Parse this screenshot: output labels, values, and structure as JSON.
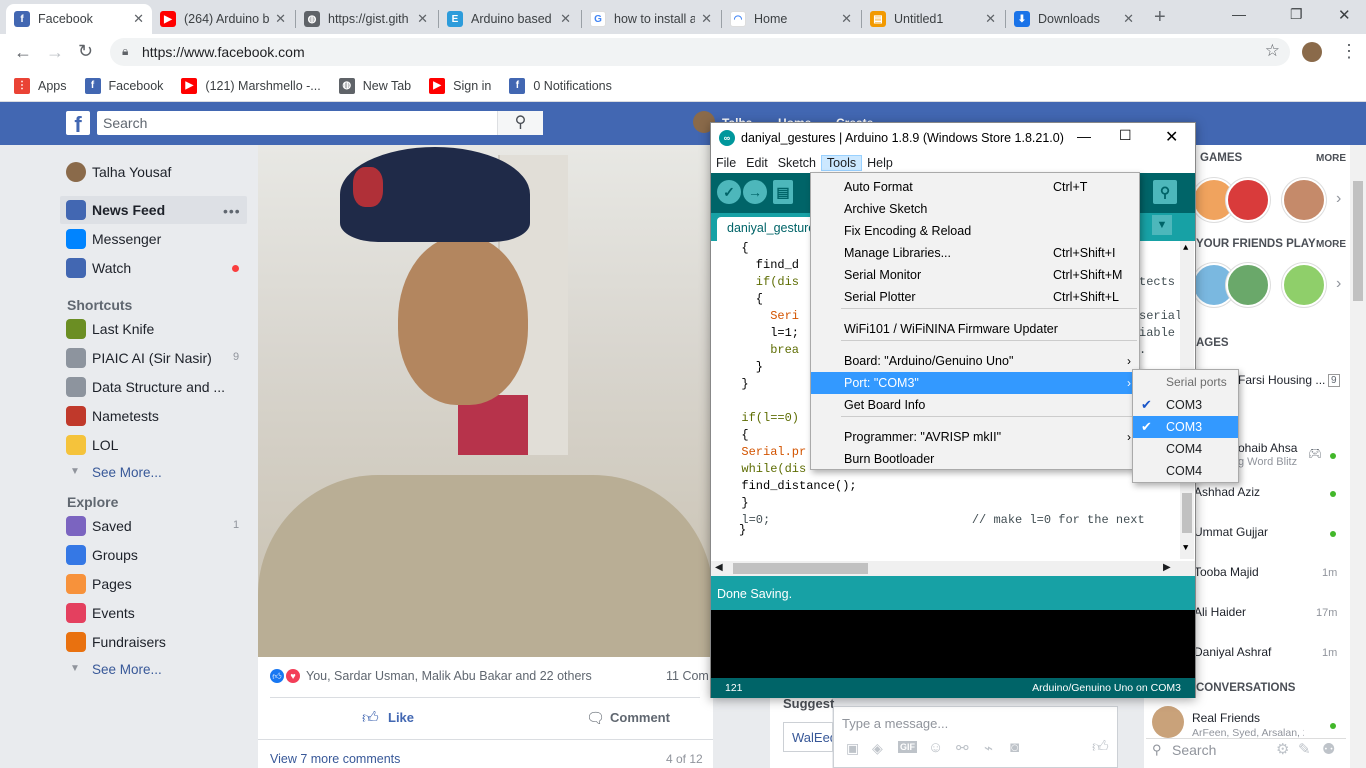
{
  "browser": {
    "tabs": [
      {
        "title": "Facebook",
        "icon": "facebook-icon",
        "color": "#4267b2",
        "glyph": "f"
      },
      {
        "title": "(264) Arduino b",
        "icon": "youtube-icon",
        "color": "#ff0000",
        "glyph": "▶"
      },
      {
        "title": "https://gist.gith",
        "icon": "globe-icon",
        "color": "#5f6368",
        "glyph": "◍"
      },
      {
        "title": "Arduino based",
        "icon": "site-e-icon",
        "color": "#2d9cdb",
        "glyph": "E"
      },
      {
        "title": "how to install a",
        "icon": "google-icon",
        "color": "#ffffff",
        "glyph": "G"
      },
      {
        "title": "Home",
        "icon": "home-site-icon",
        "color": "#ffffff",
        "glyph": "◠"
      },
      {
        "title": "Untitled1",
        "icon": "document-icon",
        "color": "#f29900",
        "glyph": "▤"
      },
      {
        "title": "Downloads",
        "icon": "download-icon",
        "color": "#1a73e8",
        "glyph": "⬇"
      }
    ],
    "url": "https://www.facebook.com",
    "bookmarks": [
      {
        "label": "Apps",
        "icon": "apps-grid-icon",
        "color": "#ea4335",
        "glyph": "⋮"
      },
      {
        "label": "Facebook",
        "icon": "facebook-icon",
        "color": "#4267b2",
        "glyph": "f"
      },
      {
        "label": "(121) Marshmello -...",
        "icon": "youtube-icon",
        "color": "#ff0000",
        "glyph": "▶"
      },
      {
        "label": "New Tab",
        "icon": "globe-icon",
        "color": "#5f6368",
        "glyph": "◍"
      },
      {
        "label": "Sign in",
        "icon": "youtube-icon",
        "color": "#ff0000",
        "glyph": "▶"
      },
      {
        "label": "0 Notifications",
        "icon": "facebook-icon",
        "color": "#4267b2",
        "glyph": "f"
      }
    ]
  },
  "facebook": {
    "search_placeholder": "Search",
    "header_links": [
      "Talha",
      "Home",
      "Create"
    ],
    "user_name": "Talha Yousaf",
    "nav_main": [
      {
        "label": "News Feed",
        "icon": "news-feed-icon",
        "color": "#4267b2"
      },
      {
        "label": "Messenger",
        "icon": "messenger-icon",
        "color": "#0084ff"
      },
      {
        "label": "Watch",
        "icon": "watch-icon",
        "color": "#4267b2"
      }
    ],
    "shortcuts_heading": "Shortcuts",
    "shortcuts": [
      {
        "label": "Last Knife",
        "icon": "game-icon",
        "color": "#6b8e23",
        "count": ""
      },
      {
        "label": "PIAIC AI (Sir Nasir)",
        "icon": "group-icon",
        "color": "#8d949e",
        "count": "9"
      },
      {
        "label": "Data Structure and ...",
        "icon": "group-icon",
        "color": "#8d949e",
        "count": ""
      },
      {
        "label": "Nametests",
        "icon": "nametests-icon",
        "color": "#c0392b",
        "count": ""
      },
      {
        "label": "LOL",
        "icon": "laugh-emoji-icon",
        "color": "#f5c33b",
        "count": ""
      }
    ],
    "see_more": "See More...",
    "explore_heading": "Explore",
    "explore": [
      {
        "label": "Saved",
        "icon": "bookmark-icon",
        "color": "#7b64c0",
        "count": "1"
      },
      {
        "label": "Groups",
        "icon": "groups-icon",
        "color": "#3578e5",
        "count": ""
      },
      {
        "label": "Pages",
        "icon": "flag-icon",
        "color": "#f7923b",
        "count": ""
      },
      {
        "label": "Events",
        "icon": "calendar-icon",
        "color": "#e4405f",
        "count": ""
      },
      {
        "label": "Fundraisers",
        "icon": "heart-icon",
        "color": "#e9710f",
        "count": ""
      }
    ],
    "post": {
      "reactions_text": "You, Sardar Usman, Malik Abu Bakar and 22 others",
      "comments_count": "11 Com",
      "like_label": "Like",
      "comment_label": "Comment",
      "view_more": "View 7 more comments",
      "pager": "4 of 12"
    },
    "right": {
      "games_heading": "GAMES",
      "more": "MORE",
      "friends_play_heading": "YOUR FRIENDS PLAY",
      "pages_heading": "AGES",
      "page_item": "Farsi Housing ...",
      "page_item_count": "9",
      "contacts": [
        {
          "name": "ohaib Ahsa",
          "sub": "g Word Blitz",
          "time": ""
        },
        {
          "name": "Ashhad Aziz",
          "sub": "",
          "time": ""
        },
        {
          "name": "Ummat Gujjar",
          "sub": "",
          "time": ""
        },
        {
          "name": "Tooba Majid",
          "sub": "",
          "time": "1m"
        },
        {
          "name": "Ali Haider",
          "sub": "",
          "time": "17m"
        },
        {
          "name": "Daniyal Ashraf",
          "sub": "",
          "time": "1m"
        }
      ],
      "conversations_heading": "CONVERSATIONS",
      "conversation_name": "Real Friends",
      "conversation_members": "ArFeen, Syed, Arsalan, 2...",
      "search_placeholder": "Search"
    },
    "chat": {
      "placeholder": "Type a message...",
      "suggest_label": "Suggest",
      "suggest_item": "WalEed"
    }
  },
  "arduino": {
    "title": "daniyal_gestures | Arduino 1.8.9 (Windows Store 1.8.21.0)",
    "menu": [
      "File",
      "Edit",
      "Sketch",
      "Tools",
      "Help"
    ],
    "tab_name": "daniyal_gestures",
    "code_lines": [
      "  {",
      "    find_d",
      "    if(dis",
      "    {",
      "      Seri",
      "      l=1;",
      "      brea",
      "    }",
      "  }",
      "",
      "  if(l==0)",
      "  {",
      "  Serial.pr",
      "  while(dis",
      "  find_distance();",
      "  }",
      "  l=0;                            // make l=0 for the next"
    ],
    "code_right_fragments": [
      "tects",
      "serial",
      "iable",
      "."
    ],
    "closing_brace": "}",
    "status": "Done Saving.",
    "footer_line": "121",
    "footer_board": "Arduino/Genuino Uno on COM3",
    "tools_menu": [
      {
        "label": "Auto Format",
        "shortcut": "Ctrl+T"
      },
      {
        "label": "Archive Sketch",
        "shortcut": ""
      },
      {
        "label": "Fix Encoding & Reload",
        "shortcut": ""
      },
      {
        "label": "Manage Libraries...",
        "shortcut": "Ctrl+Shift+I"
      },
      {
        "label": "Serial Monitor",
        "shortcut": "Ctrl+Shift+M"
      },
      {
        "label": "Serial Plotter",
        "shortcut": "Ctrl+Shift+L"
      },
      {
        "label": "WiFi101 / WiFiNINA Firmware Updater",
        "shortcut": ""
      },
      {
        "label": "Board: \"Arduino/Genuino Uno\"",
        "shortcut": ""
      },
      {
        "label": "Port: \"COM3\"",
        "shortcut": ""
      },
      {
        "label": "Get Board Info",
        "shortcut": ""
      },
      {
        "label": "Programmer: \"AVRISP mkII\"",
        "shortcut": ""
      },
      {
        "label": "Burn Bootloader",
        "shortcut": ""
      }
    ],
    "ports_heading": "Serial ports",
    "ports": [
      {
        "label": "COM3",
        "checked": true
      },
      {
        "label": "COM3",
        "checked": true
      },
      {
        "label": "COM4",
        "checked": false
      },
      {
        "label": "COM4",
        "checked": false
      }
    ]
  }
}
